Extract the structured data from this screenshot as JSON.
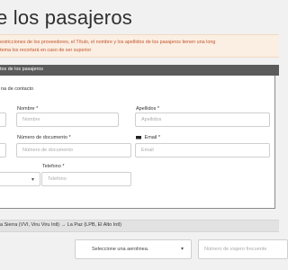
{
  "page": {
    "title": "e los pasajeros"
  },
  "notice": {
    "line1": "estricciones de los proveedores, el Título, el nombre y los apellidos de los pasajeros tienen una long",
    "line2": "tema los recortará en caso de ser superior"
  },
  "section": {
    "header": "tos de los pasajeros"
  },
  "form": {
    "contact_label": "na de contacto",
    "nombre": {
      "label": "Nombre",
      "placeholder": "Nombre",
      "required_mark": "*"
    },
    "apellidos": {
      "label": "Apellidos",
      "placeholder": "Apellidos",
      "required_mark": "*"
    },
    "documento": {
      "label": "Número de documento",
      "placeholder": "Número de documento",
      "required_mark": "*"
    },
    "email": {
      "label": "Email",
      "placeholder": "Email",
      "required_mark": "*",
      "icon": "envelope-icon"
    },
    "telefono": {
      "label": "Telefono",
      "placeholder": "Telefono",
      "required_mark": "*"
    }
  },
  "route": {
    "text": "a Sierra (VVI, Viru Viru Intl) → La Paz (LPB, El Alto Intl)"
  },
  "frequent_flyer": {
    "airline_placeholder": "Seleccione una aerolinea.",
    "number_placeholder": "Número de viajero frecuente"
  },
  "colors": {
    "notice_bg": "#fbeee3",
    "notice_text": "#c2572d",
    "section_header_bg": "#5b5b5b",
    "route_bar_bg": "#e2e2e2"
  }
}
